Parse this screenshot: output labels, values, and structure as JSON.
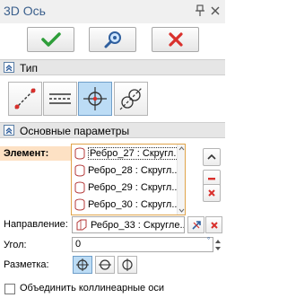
{
  "window": {
    "title": "3D Ось"
  },
  "icons": {
    "pin": "pin-icon",
    "close": "close-icon",
    "ok": "checkmark-icon",
    "preview": "preview-icon",
    "cancel": "cancel-icon"
  },
  "colors": {
    "accent_blue": "#3a5f8c",
    "ok_green": "#2e9e3a",
    "cancel_red": "#d9302c",
    "active_fill": "#bcdcf5",
    "element_highlight": "#fde1c4",
    "list_border": "#e0a44a"
  },
  "type_section": {
    "label": "Тип",
    "options": [
      "line-two-points-icon",
      "line-parallel-icon",
      "axis-from-point-icon",
      "axis-between-circles-icon"
    ],
    "active_index": 2
  },
  "params_section": {
    "label": "Основные параметры",
    "element_label": "Элемент:",
    "elements": [
      "Ребро_27 : Скругл...",
      "Ребро_28 : Скругл...",
      "Ребро_29 : Скругл...",
      "Ребро_30 : Скругл..."
    ],
    "selected_index": 0,
    "direction_label": "Направление:",
    "direction_value": "Ребро_33 : Скругле...",
    "angle_label": "Угол:",
    "angle_value": "0",
    "marking_label": "Разметка:",
    "marking_active_index": 0,
    "merge_label": "Объединить коллинеарные оси",
    "merge_checked": false
  }
}
